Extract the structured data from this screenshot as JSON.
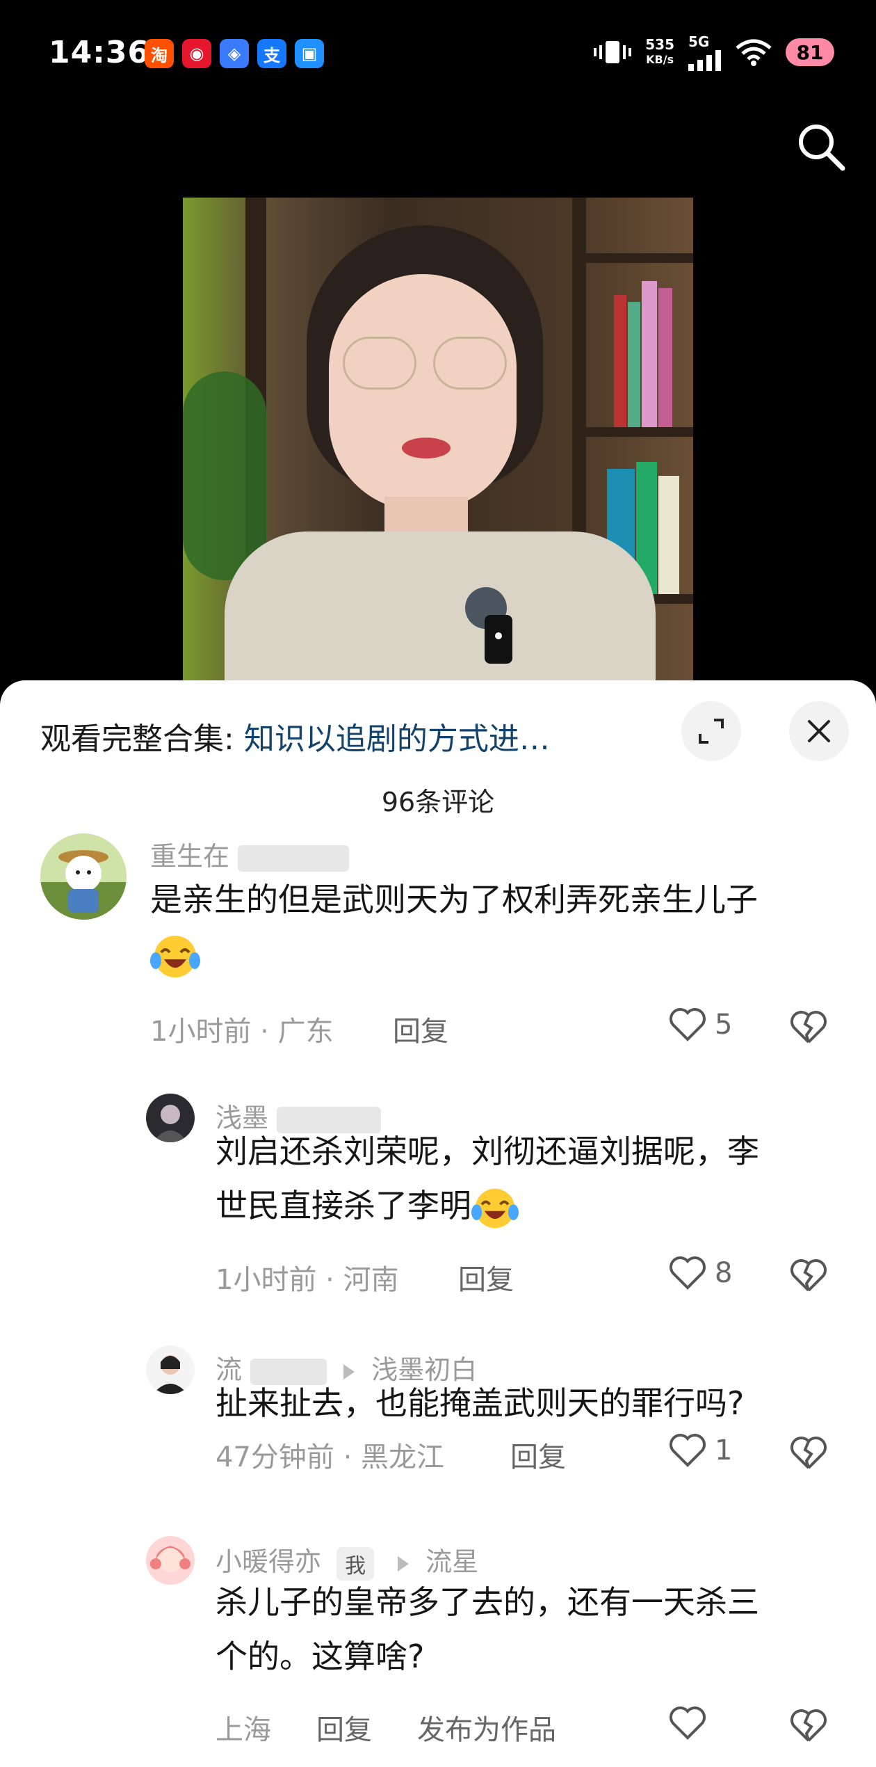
{
  "status": {
    "time": "14:36",
    "app_icons": [
      {
        "name": "taobao-icon",
        "char": "淘",
        "color": "#ff5000"
      },
      {
        "name": "weibo-icon",
        "char": "◉",
        "color": "#e6162d"
      },
      {
        "name": "baidu-netdisk-icon",
        "char": "◈",
        "color": "#3a7bfd"
      },
      {
        "name": "alipay-icon",
        "char": "支",
        "color": "#1677ff"
      },
      {
        "name": "tencent-icon",
        "char": "▣",
        "color": "#1e90ff"
      }
    ],
    "net_speed_value": "535",
    "net_speed_unit": "KB/s",
    "network": "5G",
    "battery": "81"
  },
  "sheet": {
    "collection_prefix": "观看完整合集:",
    "collection_link": "知识以追剧的方式进…",
    "comment_count": "96条评论"
  },
  "comments": [
    {
      "username": "重生在",
      "text": "是亲生的但是武则天为了权利弄死亲生儿子",
      "emoji": "laugh-cry",
      "time_location": "1小时前 · 广东",
      "reply_label": "回复",
      "likes": "5"
    },
    {
      "username": "浅墨",
      "text_line1": "刘启还杀刘荣呢，刘彻还逼刘据呢，李",
      "text_line2": "世民直接杀了李明",
      "emoji": "laugh-cry",
      "time_location": "1小时前 · 河南",
      "reply_label": "回复",
      "likes": "8"
    },
    {
      "username": "流",
      "reply_to": "浅墨初白",
      "text": "扯来扯去，也能掩盖武则天的罪行吗?",
      "time_location": "47分钟前 · 黑龙江",
      "reply_label": "回复",
      "likes": "1"
    },
    {
      "username": "小暖得亦",
      "me_tag": "我",
      "reply_to": "流星",
      "text_line1": "杀儿子的皇帝多了去的，还有一天杀三",
      "text_line2": "个的。这算啥?",
      "location": "上海",
      "reply_label": "回复",
      "publish_label": "发布为作品"
    }
  ]
}
